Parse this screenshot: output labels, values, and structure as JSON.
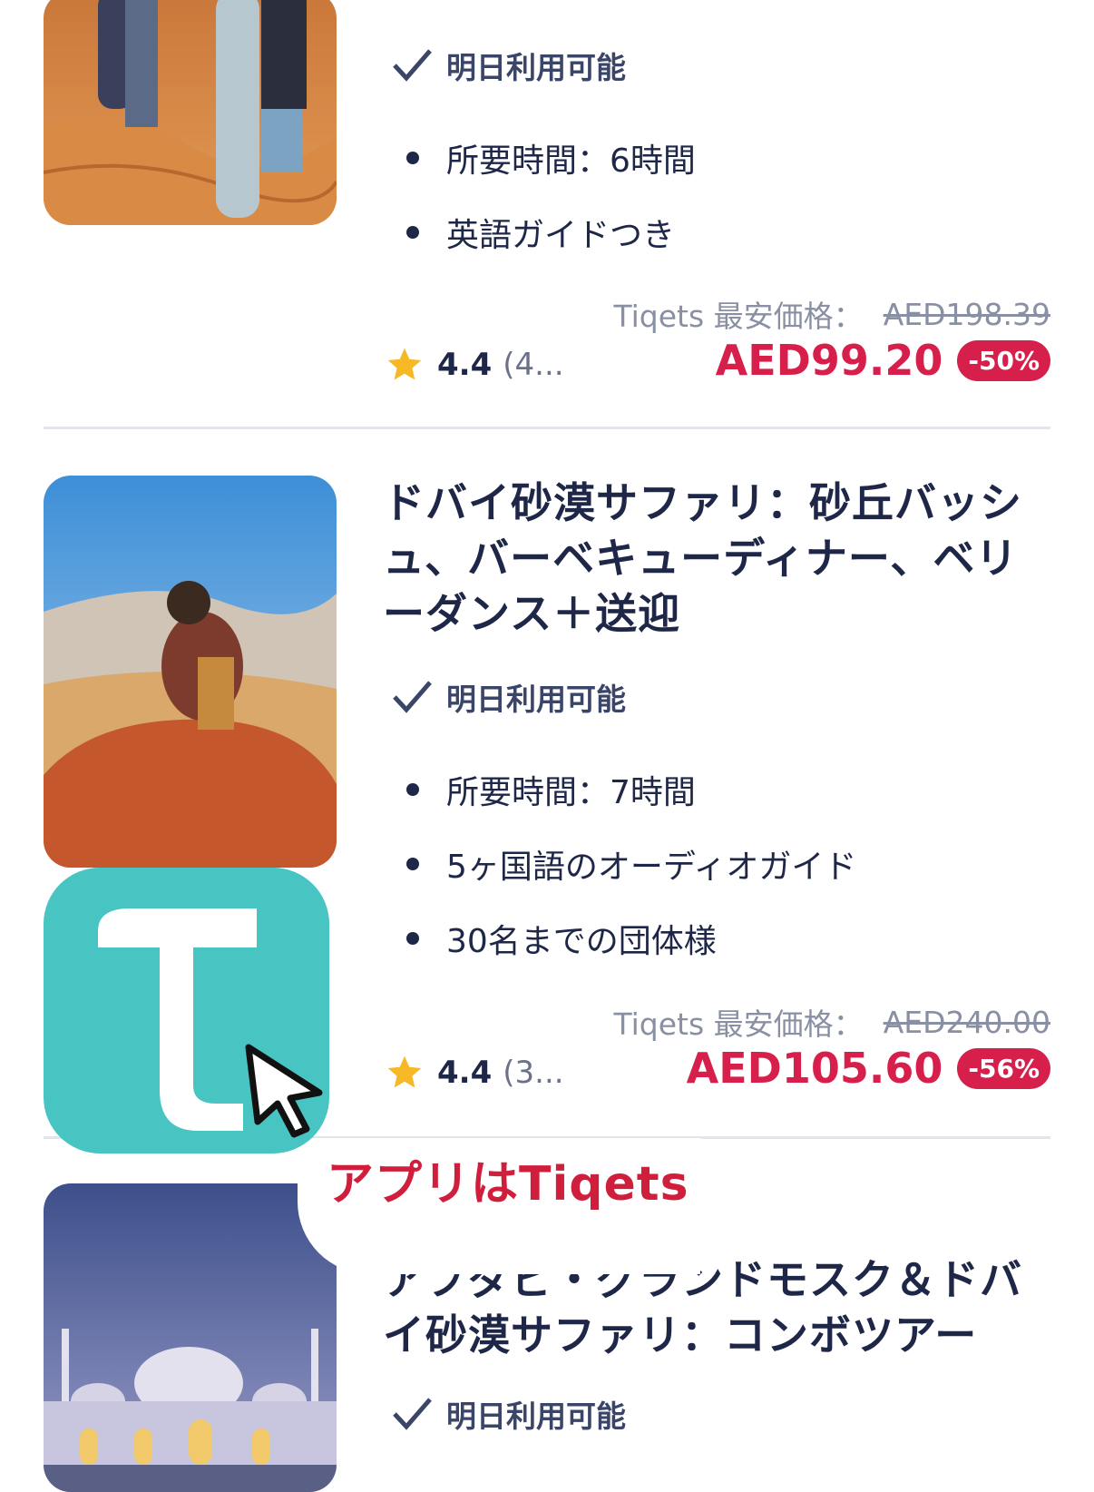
{
  "colors": {
    "accent": "#d71f4b",
    "text": "#1e2747",
    "muted": "#8a90a3",
    "app_icon": "#48c5c3",
    "star": "#f6b824"
  },
  "listings": [
    {
      "availability": "明日利用可能",
      "features": [
        "所要時間：6時間",
        "英語ガイドつき"
      ],
      "price_label": "Tiqets 最安価格：",
      "original_price": "AED198.39",
      "price": "AED99.20",
      "discount": "-50%",
      "rating": "4.4",
      "review_count": "(4..."
    },
    {
      "title": "ドバイ砂漠サファリ：砂丘バッシュ、バーベキューディナー、ベリーダンス＋送迎",
      "availability": "明日利用可能",
      "features": [
        "所要時間：7時間",
        "5ヶ国語のオーディオガイド",
        "30名までの団体様"
      ],
      "price_label": "Tiqets 最安価格：",
      "original_price": "AED240.00",
      "price": "AED105.60",
      "discount": "-56%",
      "rating": "4.4",
      "review_count": "(3..."
    },
    {
      "title": "アブダビ・グランドモスク＆ドバイ砂漠サファリ：コンボツアー",
      "availability": "明日利用可能"
    }
  ],
  "overlay": {
    "app_icon": "tiqets-app-icon",
    "cursor": "cursor-arrow-icon",
    "caption": "アプリはTiqets"
  }
}
